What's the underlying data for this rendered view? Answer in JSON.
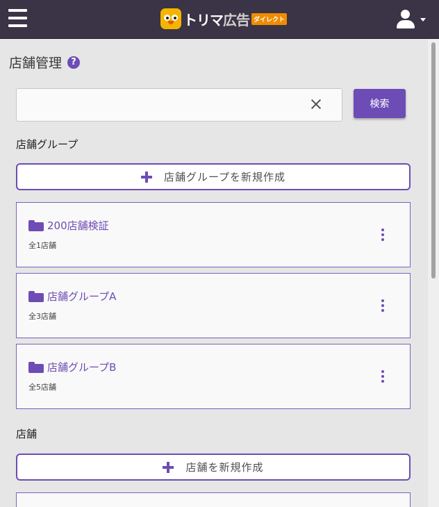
{
  "header": {
    "logo_text": "トリマ",
    "logo_text_ad": "広告",
    "logo_badge": "ダイレクト",
    "menu_icon": "hamburger-icon",
    "user_icon": "user-icon"
  },
  "page": {
    "title": "店舗管理",
    "help_symbol": "?"
  },
  "search": {
    "value": "",
    "placeholder": "",
    "button_label": "検索"
  },
  "groups_section": {
    "title": "店舗グループ",
    "add_button_label": "店舗グループを新規作成",
    "items": [
      {
        "name": "200店舗検証",
        "count": "全1店舗"
      },
      {
        "name": "店舗グループA",
        "count": "全3店舗"
      },
      {
        "name": "店舗グループB",
        "count": "全5店舗"
      }
    ]
  },
  "stores_section": {
    "title": "店舗",
    "add_button_label": "店舗を新規作成"
  },
  "colors": {
    "accent": "#6d4cb6",
    "header_bg": "#3b3346",
    "logo_yellow": "#f5b400",
    "badge_orange": "#f08c00"
  }
}
